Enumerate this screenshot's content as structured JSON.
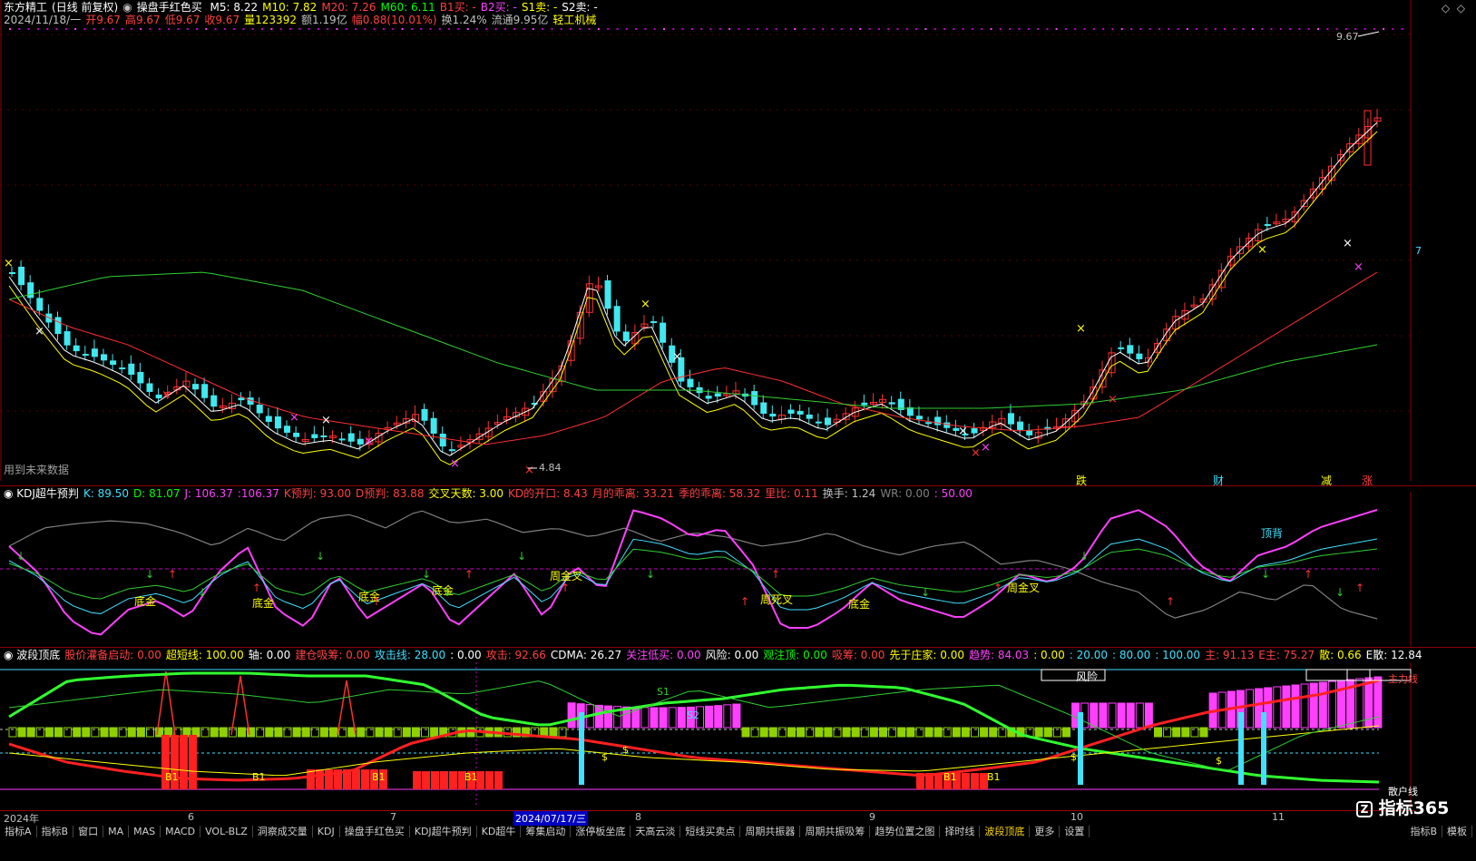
{
  "header": {
    "stock_name": "东方精工",
    "chart_mode": "(日线 前复权)",
    "indicator_name": "操盘手红色买",
    "ma_items": [
      {
        "label": "M5: 8.22",
        "color": "#ffffff"
      },
      {
        "label": "M10: 7.82",
        "color": "#ffff00"
      },
      {
        "label": "M20: 7.26",
        "color": "#ff4040"
      },
      {
        "label": "M60: 6.11",
        "color": "#00ff00"
      },
      {
        "label": "B1买: -",
        "color": "#ff4040"
      },
      {
        "label": "B2买: -",
        "color": "#ff40ff"
      },
      {
        "label": "S1卖: -",
        "color": "#ffff00"
      },
      {
        "label": "S2卖: -",
        "color": "#ffffff"
      }
    ],
    "quote_items": [
      {
        "label": "2024/11/18/一",
        "color": "#c0c0c0"
      },
      {
        "label": "开9.67",
        "color": "#ff4040"
      },
      {
        "label": "高9.67",
        "color": "#ff4040"
      },
      {
        "label": "低9.67",
        "color": "#ff4040"
      },
      {
        "label": "收9.67",
        "color": "#ff4040"
      },
      {
        "label": "量123392",
        "color": "#ffff00"
      },
      {
        "label": "额1.19亿",
        "color": "#c0c0c0"
      },
      {
        "label": "幅0.88(10.01%)",
        "color": "#ff4040"
      },
      {
        "label": "换1.24%",
        "color": "#c0c0c0"
      },
      {
        "label": "流通9.95亿",
        "color": "#c0c0c0"
      },
      {
        "label": "轻工机械",
        "color": "#ffff00"
      }
    ],
    "price_high_label": "9.67",
    "price_low_label": "4.84",
    "future_data_note": "用到未来数据",
    "signal_labels": [
      "跌",
      "财",
      "减",
      "涨"
    ]
  },
  "kdj": {
    "title": "KDJ超牛预判",
    "items": [
      {
        "label": "K: 89.50",
        "color": "#40e0ff"
      },
      {
        "label": "D: 81.07",
        "color": "#00ff00"
      },
      {
        "label": "J: 106.37",
        "color": "#ff40ff"
      },
      {
        "label": ":106.37",
        "color": "#ff40ff"
      },
      {
        "label": "K预判: 93.00",
        "color": "#ff4040"
      },
      {
        "label": "D预判: 83.88",
        "color": "#ff4040"
      },
      {
        "label": "交叉天数: 3.00",
        "color": "#ffff00"
      },
      {
        "label": "KD的开口: 8.43",
        "color": "#ff4040"
      },
      {
        "label": "月的乖离: 33.21",
        "color": "#ff4040"
      },
      {
        "label": "季的乖离: 58.32",
        "color": "#ff4040"
      },
      {
        "label": "里比: 0.11",
        "color": "#ff4040"
      },
      {
        "label": "换手: 1.24",
        "color": "#c0c0c0"
      },
      {
        "label": "WR: 0.00",
        "color": "#808080"
      },
      {
        "label": ": 50.00",
        "color": "#ff40ff"
      }
    ],
    "annotations": [
      "底金",
      "底金",
      "底金",
      "底金",
      "周金叉",
      "周死叉",
      "底金",
      "周金叉",
      "顶背"
    ]
  },
  "wave": {
    "title": "波段顶底",
    "items": [
      {
        "label": "股价灌备启动: 0.00",
        "color": "#ff4040"
      },
      {
        "label": "超短线: 100.00",
        "color": "#ffff00"
      },
      {
        "label": "轴: 0.00",
        "color": "#ffffff"
      },
      {
        "label": "建仓吸筹: 0.00",
        "color": "#ff4040"
      },
      {
        "label": "攻击线: 28.00",
        "color": "#40e0ff"
      },
      {
        "label": ": 0.00",
        "color": "#ffffff"
      },
      {
        "label": "攻击: 92.66",
        "color": "#ff4040"
      },
      {
        "label": "CDMA: 26.27",
        "color": "#ffffff"
      },
      {
        "label": "关注低买: 0.00",
        "color": "#ff40ff"
      },
      {
        "label": "风险: 0.00",
        "color": "#ffffff"
      },
      {
        "label": "观注顶: 0.00",
        "color": "#00ff00"
      },
      {
        "label": "吸筹: 0.00",
        "color": "#ff4040"
      },
      {
        "label": "先于庄家: 0.00",
        "color": "#ffff00"
      },
      {
        "label": "趋势: 84.03",
        "color": "#ff40ff"
      },
      {
        "label": ": 0.00",
        "color": "#ffff00"
      },
      {
        "label": ": 20.00",
        "color": "#40e0ff"
      },
      {
        "label": ": 80.00",
        "color": "#40e0ff"
      },
      {
        "label": ": 100.00",
        "color": "#40e0ff"
      },
      {
        "label": "主: 91.13",
        "color": "#ff4040"
      },
      {
        "label": "E主: 75.27",
        "color": "#ff4040"
      },
      {
        "label": "散: 0.66",
        "color": "#ffff00"
      },
      {
        "label": "E散: 12.84",
        "color": "#ffffff"
      }
    ],
    "risk_label": "风险",
    "main_force_label": "主力线",
    "retail_label": "散户线",
    "signals": [
      "S1",
      "S2",
      "B1",
      "B1",
      "B1",
      "B1",
      "B1",
      "B1"
    ]
  },
  "x_axis": {
    "labels": [
      "2024年",
      "6",
      "7",
      "8",
      "9",
      "10",
      "11"
    ],
    "selected_date": "2024/07/17/三"
  },
  "bottom_tabs": [
    "指标A",
    "指标B",
    "窗口",
    "MA",
    "MAS",
    "MACD",
    "VOL-BLZ",
    "洞察成交量",
    "KDJ",
    "操盘手红色买",
    "KDJ超牛预判",
    "KD超牛",
    "筹集启动",
    "涨停板坐底",
    "天高云淡",
    "短线买卖点",
    "周期共振器",
    "周期共振吸筹",
    "趋势位置之图",
    "择时线",
    "波段顶底",
    "更多",
    "设置"
  ],
  "right_tabs": [
    "指标B",
    "模板"
  ],
  "watermark": "指标365"
}
